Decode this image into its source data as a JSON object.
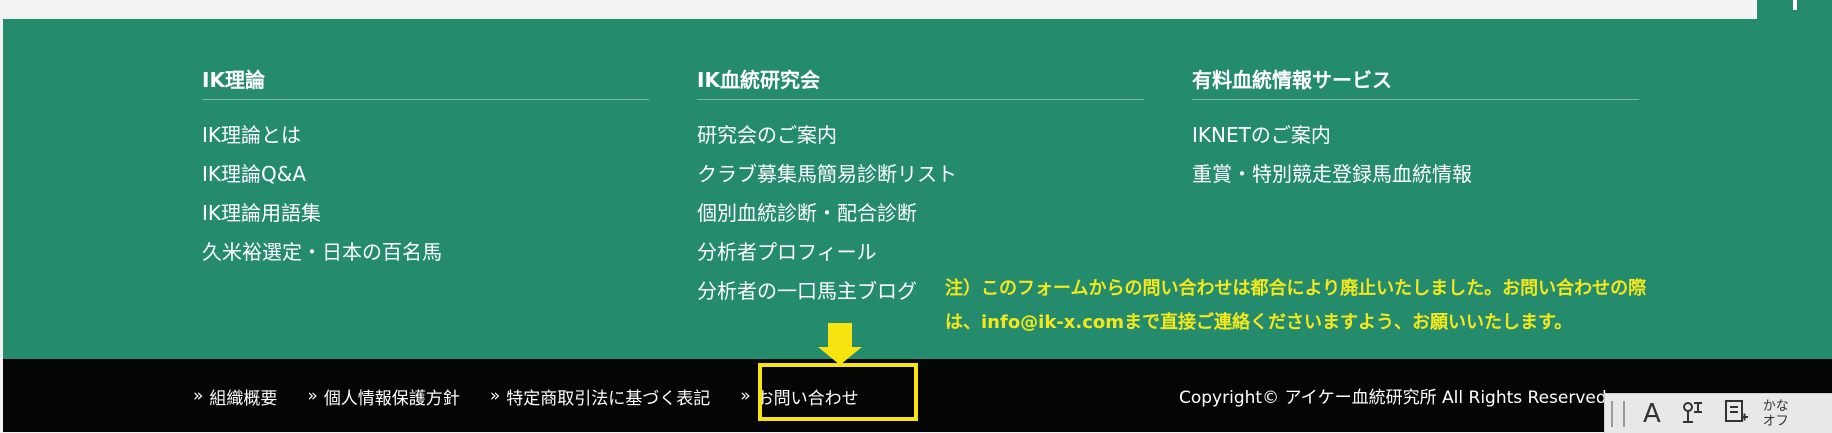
{
  "columns": [
    {
      "title": "IK理論",
      "links": [
        "IK理論とは",
        "IK理論Q&A",
        "IK理論用語集",
        "久米裕選定・日本の百名馬"
      ]
    },
    {
      "title": "IK血統研究会",
      "links": [
        "研究会のご案内",
        "クラブ募集馬簡易診断リスト",
        "個別血統診断・配合診断",
        "分析者プロフィール",
        "分析者の一口馬主ブログ"
      ]
    },
    {
      "title": "有料血統情報サービス",
      "links": [
        "IKNETのご案内",
        "重賞・特別競走登録馬血統情報"
      ]
    }
  ],
  "notice": {
    "line1": "注）このフォームからの問い合わせは都合により廃止いたしました。お問い合わせの際",
    "line2": "は、info@ik-x.comまで直接ご連絡くださいますよう、お願いいたします。"
  },
  "bottom_links": [
    "組織概要",
    "個人情報保護方針",
    "特定商取引法に基づく表記",
    "お問い合わせ"
  ],
  "chevron": "»",
  "copyright": "Copyright© アイケー血統研究所 All Rights Reserved",
  "ime": {
    "mode_glyph": "A",
    "small_line1": "かな",
    "small_line2": "オフ"
  },
  "colors": {
    "footer_green": "#258b6d",
    "notice_yellow": "#f3e81e",
    "highlight_yellow": "#f6e30f",
    "bottom_bar": "#050505"
  }
}
